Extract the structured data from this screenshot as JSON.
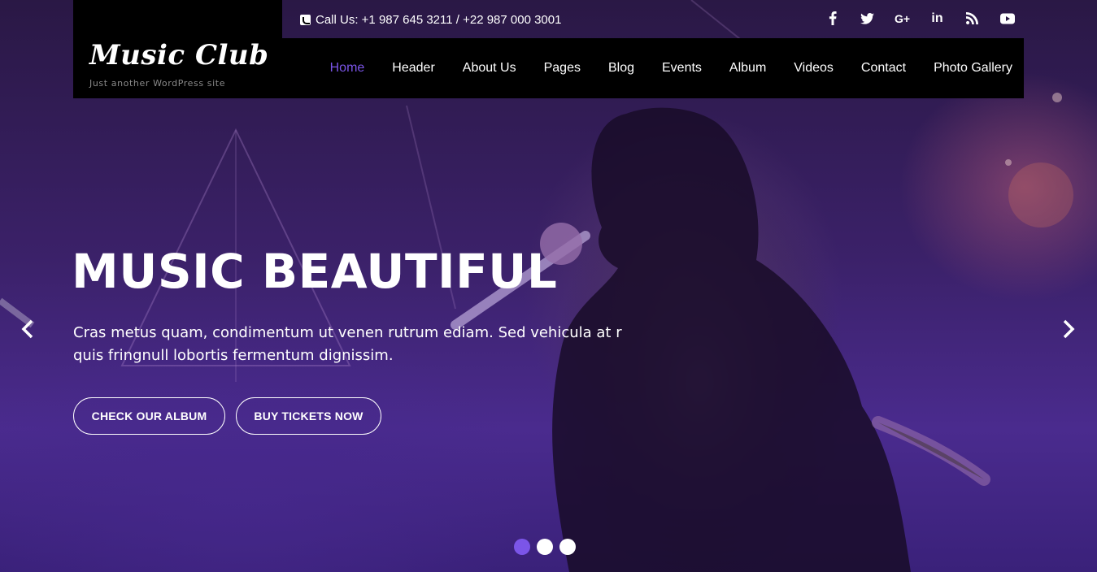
{
  "brand": {
    "title": "Music Club",
    "tagline": "Just another WordPress site"
  },
  "topbar": {
    "call_text": "Call Us: +1 987 645 3211 / +22 987 000 3001",
    "socials": [
      {
        "name": "facebook-icon",
        "glyph": "f"
      },
      {
        "name": "twitter-icon",
        "glyph": "🐦"
      },
      {
        "name": "google-plus-icon",
        "glyph": "G+"
      },
      {
        "name": "linkedin-icon",
        "glyph": "in"
      },
      {
        "name": "rss-icon",
        "glyph": "))"
      },
      {
        "name": "youtube-icon",
        "glyph": "▶"
      }
    ]
  },
  "nav": {
    "items": [
      "Home",
      "Header",
      "About Us",
      "Pages",
      "Blog",
      "Events",
      "Album",
      "Videos",
      "Contact",
      "Photo Gallery"
    ],
    "active_index": 0,
    "active_color": "#7b55e8"
  },
  "slide": {
    "headline": "MUSIC BEAUTIFUL",
    "subtext": "Cras metus quam, condimentum ut venen rutrum ediam. Sed vehicula at r quis fringnull lobortis fermentum dignissim.",
    "button_album": "CHECK OUR ALBUM",
    "button_tickets": "BUY TICKETS NOW"
  },
  "slider": {
    "slide_count": 3,
    "active_slide": 1
  }
}
